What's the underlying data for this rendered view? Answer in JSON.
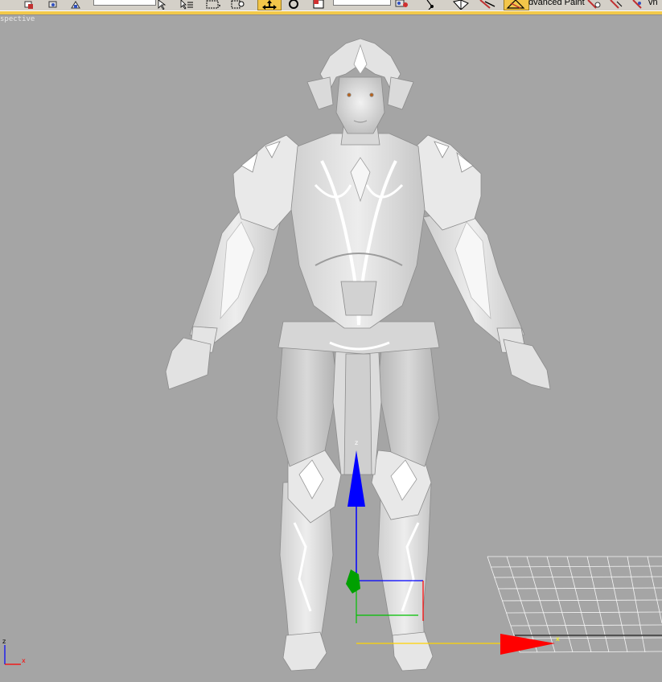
{
  "toolbar": {
    "paint_label": "dvanced Paint",
    "extra_label": "vn"
  },
  "viewport": {
    "label": "spective",
    "axis": {
      "z": "z",
      "x": "x"
    },
    "gizmo": {
      "x": "x",
      "z": "z"
    }
  },
  "colors": {
    "viewport_bg": "#a5a5a5",
    "toolbar_bg": "#d4d0c8",
    "active_button": "#f3c64a",
    "gizmo_x": "#ff0000",
    "gizmo_y": "#00c000",
    "gizmo_z": "#0000ff",
    "grid": "#ffffff"
  }
}
